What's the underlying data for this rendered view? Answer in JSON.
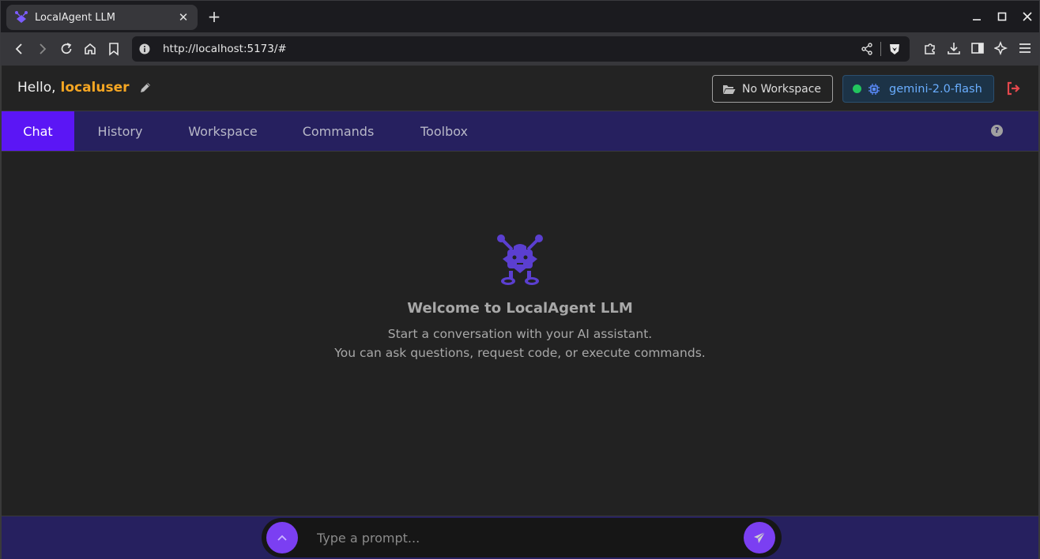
{
  "browser": {
    "tab_title": "LocalAgent LLM",
    "url": "http://localhost:5173/#",
    "icons": [
      "back-icon",
      "forward-icon",
      "reload-icon",
      "home-icon",
      "bookmark-icon",
      "site-info-icon",
      "share-icon",
      "brave-shield-icon",
      "extensions-icon",
      "downloads-icon",
      "sidebar-icon",
      "leo-ai-icon",
      "menu-icon"
    ]
  },
  "header": {
    "greeting": "Hello,",
    "username": "localuser",
    "workspace_label": "No Workspace",
    "model_label": "gemini-2.0-flash",
    "model_status_color": "#22c55e"
  },
  "nav": {
    "tabs": [
      {
        "label": "Chat",
        "active": true
      },
      {
        "label": "History",
        "active": false
      },
      {
        "label": "Workspace",
        "active": false
      },
      {
        "label": "Commands",
        "active": false
      },
      {
        "label": "Toolbox",
        "active": false
      }
    ],
    "help_label": "?"
  },
  "welcome": {
    "title": "Welcome to LocalAgent LLM",
    "line1": "Start a conversation with your AI assistant.",
    "line2": "You can ask questions, request code, or execute commands."
  },
  "prompt": {
    "placeholder": "Type a prompt...",
    "value": ""
  },
  "colors": {
    "accent": "#5b16f5",
    "nav_bg": "#26205f",
    "username": "#f5a623",
    "model_text": "#6aaeff",
    "logout": "#e5484d"
  }
}
